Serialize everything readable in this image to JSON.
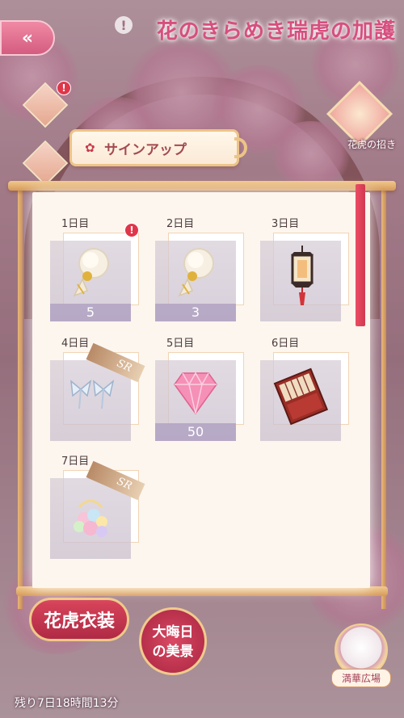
{
  "header": {
    "back_label": "«",
    "event_title": "花のきらめき瑞虎の加護",
    "alert_symbol": "!"
  },
  "side": {
    "tiger_invite_label": "花虎の招き"
  },
  "signin": {
    "title": "サインアップ",
    "days": [
      {
        "label": "1日目",
        "count": "5",
        "item": "white-tassel-icon",
        "alert": "!"
      },
      {
        "label": "2日目",
        "count": "3",
        "item": "white-tassel-icon"
      },
      {
        "label": "3日目",
        "count": "",
        "item": "lantern-icon"
      },
      {
        "label": "4日目",
        "count": "",
        "item": "butterfly-earrings-icon",
        "badge": "SR"
      },
      {
        "label": "5日目",
        "count": "50",
        "item": "pink-diamond-icon"
      },
      {
        "label": "6日目",
        "count": "",
        "item": "folding-screen-icon"
      },
      {
        "label": "7日目",
        "count": "",
        "item": "pastel-flower-ornament-icon",
        "badge": "SR"
      }
    ]
  },
  "bottom": {
    "costume_button": "花虎衣装",
    "new_year_line1": "大晦日",
    "new_year_line2": "の美景",
    "plaza_label": "満華広場",
    "time_left": "残り7日18時間13分"
  },
  "colors": {
    "accent": "#d64f7e",
    "frame_gold": "#edc488",
    "alert_red": "#e0364a",
    "count_bar": "#b4a5c4"
  }
}
